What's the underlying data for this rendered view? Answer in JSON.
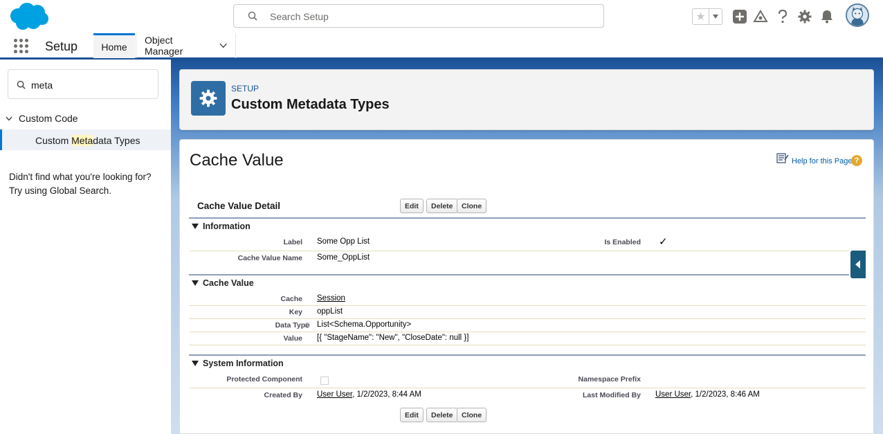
{
  "global_header": {
    "search_placeholder": "Search Setup"
  },
  "context_bar": {
    "app_name": "Setup",
    "tabs": [
      {
        "label": "Home",
        "active": true
      },
      {
        "label": "Object Manager",
        "active": false
      }
    ]
  },
  "sidebar": {
    "quickfind_value": "meta",
    "tree_parent": "Custom Code",
    "tree_child_pre": "Custom ",
    "tree_child_match": "Meta",
    "tree_child_post": "data Types",
    "not_found_line1": "Didn't find what you're looking for?",
    "not_found_line2": "Try using Global Search."
  },
  "setup_header": {
    "eyebrow": "SETUP",
    "title": "Custom Metadata Types"
  },
  "main": {
    "page_title": "Cache Value",
    "help_link": "Help for this Page",
    "detail_title": "Cache Value Detail",
    "buttons": {
      "edit": "Edit",
      "delete": "Delete",
      "clone": "Clone"
    },
    "sections": {
      "information": {
        "title": "Information",
        "label_label": "Label",
        "label_value": "Some Opp List",
        "is_enabled_label": "Is Enabled",
        "is_enabled_value": "✓",
        "cache_value_name_label": "Cache Value Name",
        "cache_value_name_value": "Some_OppList"
      },
      "cache_value": {
        "title": "Cache Value",
        "cache_label": "Cache",
        "cache_value": "Session",
        "key_label": "Key",
        "key_value": "oppList",
        "data_type_label": "Data Type",
        "data_type_value": "List<Schema.Opportunity>",
        "value_label": "Value",
        "value_value": "[{ \"StageName\": \"New\", \"CloseDate\": null }]"
      },
      "system": {
        "title": "System Information",
        "protected_label": "Protected Component",
        "namespace_label": "Namespace Prefix",
        "created_by_label": "Created By",
        "created_by_user": "User User",
        "created_by_date": ", 1/2/2023, 8:44 AM",
        "modified_by_label": "Last Modified By",
        "modified_by_user": "User User",
        "modified_by_date": ", 1/2/2023, 8:46 AM"
      }
    }
  },
  "colors": {
    "brand_blue": "#1b5297",
    "link_blue": "#015ba7",
    "salesforce_cloud": "#00a1e0"
  }
}
